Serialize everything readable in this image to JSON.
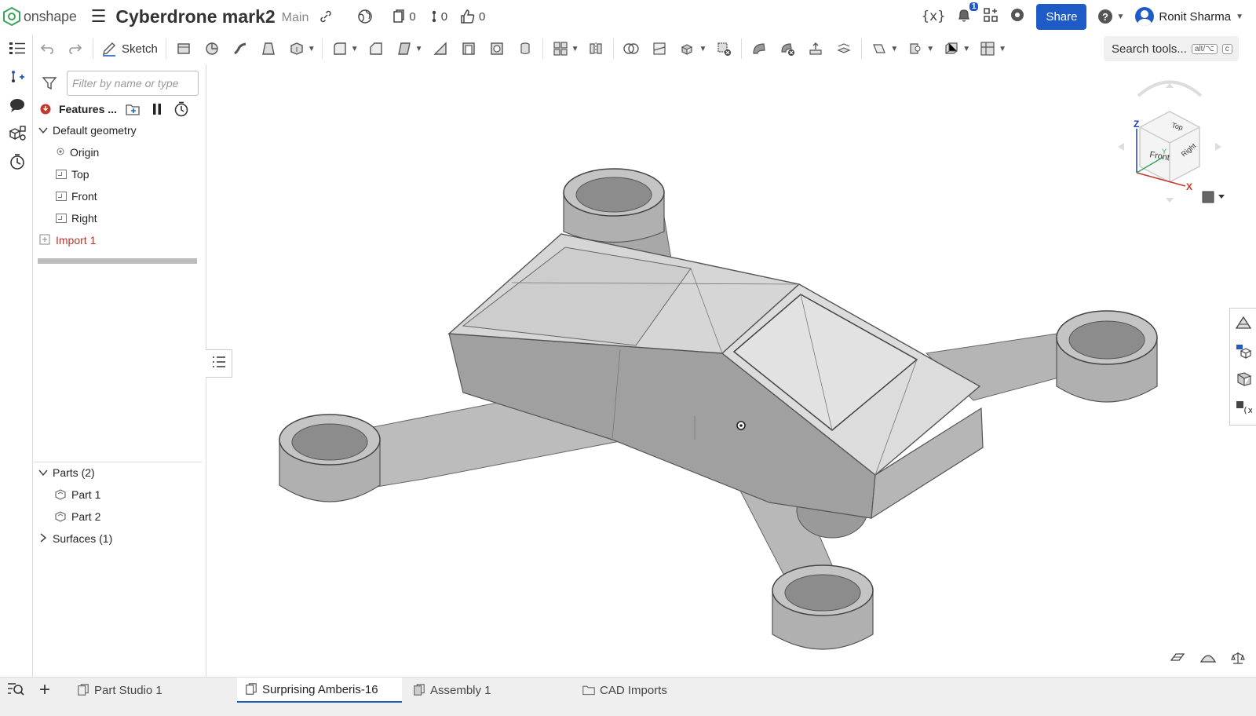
{
  "app": {
    "logo_text": "onshape",
    "document_title": "Cyberdrone mark2",
    "branch": "Main",
    "versions_count": "0",
    "branches_count": "0",
    "likes_count": "0",
    "notifications_count": "1",
    "share_label": "Share",
    "user_name": "Ronit Sharma"
  },
  "toolbar": {
    "sketch_label": "Sketch",
    "search_label": "Search tools...",
    "search_shortcut": "alt/⌥",
    "search_key": "c"
  },
  "feature_panel": {
    "filter_placeholder": "Filter by name or type",
    "features_label": "Features ...",
    "default_geometry_label": "Default geometry",
    "origin_label": "Origin",
    "top_label": "Top",
    "front_label": "Front",
    "right_label": "Right",
    "import_label": "Import 1"
  },
  "parts_panel": {
    "parts_label": "Parts (2)",
    "part1_label": "Part 1",
    "part2_label": "Part 2",
    "surfaces_label": "Surfaces (1)"
  },
  "viewcube": {
    "top": "Top",
    "front": "Front",
    "right": "Right",
    "axis_z": "Z",
    "axis_x": "X",
    "axis_y": "Y"
  },
  "tabs": [
    {
      "label": "Part Studio 1"
    },
    {
      "label": "Surprising Amberis-16"
    },
    {
      "label": "Assembly 1"
    },
    {
      "label": "CAD Imports"
    }
  ],
  "colors": {
    "accent": "#1e5bc6",
    "error": "#b03a2e",
    "model_fill": "#c8c8c8"
  }
}
